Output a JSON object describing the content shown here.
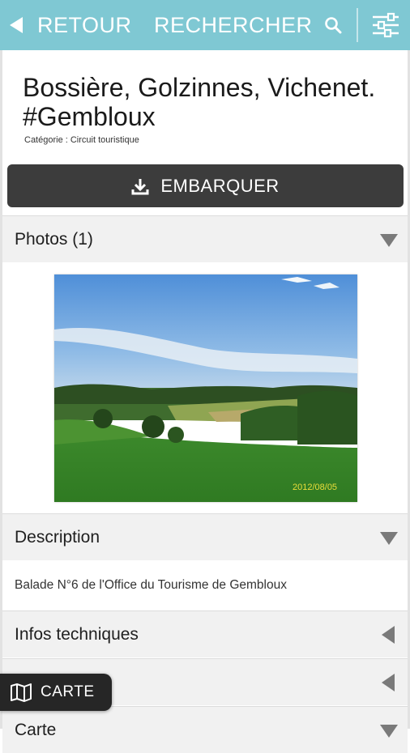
{
  "header": {
    "back_label": "RETOUR",
    "search_label": "RECHERCHER"
  },
  "place": {
    "title": "Bossière, Golzinnes, Vichenet. #Gembloux",
    "category": "Catégorie : Circuit touristique"
  },
  "actions": {
    "download_label": "EMBARQUER",
    "map_label": "CARTE"
  },
  "sections": {
    "photos_label": "Photos (1)",
    "description_label": "Description",
    "description_text": "Balade N°6 de l'Office du Tourisme de Gembloux",
    "tech_label": "Infos techniques",
    "hidden_label": "",
    "map_section_label": "Carte"
  },
  "photo": {
    "date_stamp": "2012/08/05"
  },
  "colors": {
    "topbar": "#7fc8d3",
    "download_button": "#3c3c3c",
    "section_bg": "#f1f1f1"
  }
}
